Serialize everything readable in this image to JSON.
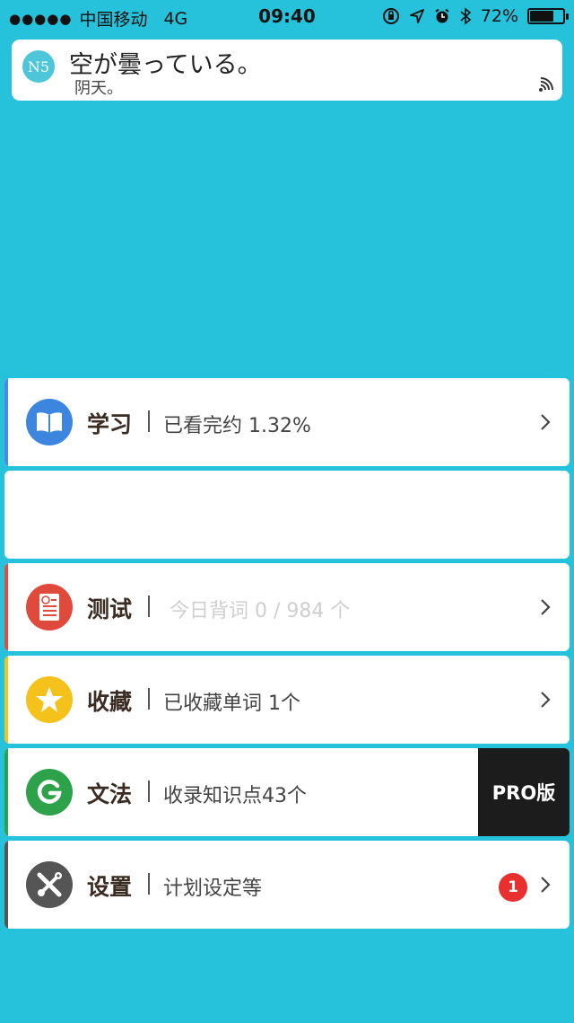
{
  "status_bar": {
    "signal_dots": "●●●●●",
    "carrier": "中国移动",
    "network": "4G",
    "time": "09:40",
    "battery_text": "72%",
    "battery_level": 0.72,
    "icons": [
      "orientation-lock-icon",
      "location-icon",
      "alarm-icon",
      "bluetooth-icon"
    ]
  },
  "notification": {
    "app_badge": "N5",
    "title": "空が曇っている。",
    "subtitle": "阴天。"
  },
  "menu": [
    {
      "icon": "book-icon",
      "title": "学习",
      "desc": "已看完约 1.32%",
      "accent": "#4c86e8",
      "icon_bg": "#3d86e0"
    },
    {
      "blank": true
    },
    {
      "icon": "test-sheet-icon",
      "title": "测试",
      "desc": "今日背词 0 / 984 个",
      "accent": "#e44c3c",
      "icon_bg": "#e04a3c"
    },
    {
      "icon": "star-icon",
      "title": "收藏",
      "desc": "已收藏单词 1个",
      "accent": "#f5c21b",
      "icon_bg": "#f5c21b"
    },
    {
      "icon": "grammar-g-icon",
      "title": "文法",
      "desc": "收录知识点43个",
      "accent": "#2da24a",
      "icon_bg": "#2da24a",
      "pro_label": "PRO版"
    },
    {
      "icon": "tools-icon",
      "title": "设置",
      "desc": "计划设定等",
      "accent": "#555555",
      "icon_bg": "#555555",
      "badge": "1"
    }
  ]
}
